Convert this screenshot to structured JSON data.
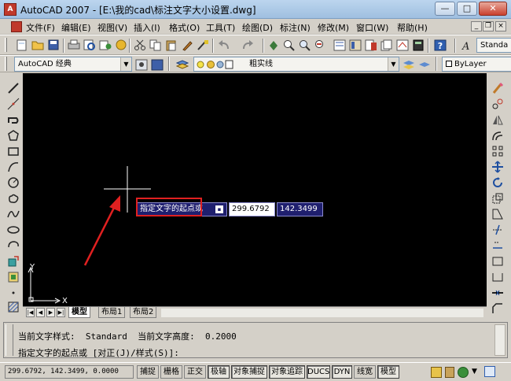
{
  "window": {
    "title": "AutoCAD 2007 - [E:\\我的cad\\标注文字大小设置.dwg]",
    "min_label": "—",
    "max_label": "□",
    "close_label": "✕"
  },
  "menu": {
    "items": [
      "文件(F)",
      "编辑(E)",
      "视图(V)",
      "插入(I)",
      "格式(O)",
      "工具(T)",
      "绘图(D)",
      "标注(N)",
      "修改(M)",
      "窗口(W)",
      "帮助(H)"
    ],
    "mdi_min": "_",
    "mdi_restore": "❐",
    "mdi_close": "×"
  },
  "toolbar": {
    "text_style_combo": "Standa",
    "workspace_combo": "AutoCAD 经典",
    "layer_combo": "粗实线",
    "color_combo": "ByLayer"
  },
  "canvas": {
    "prompt_label": "指定文字的起点或",
    "x_value": "299.6792",
    "y_value": "142.3499",
    "ucs_y": "Y",
    "ucs_x": "X"
  },
  "tabs": {
    "items": [
      "模型",
      "布局1",
      "布局2"
    ],
    "active": "模型"
  },
  "command": {
    "line1": "当前文字样式:  Standard  当前文字高度:  0.2000",
    "line2": "指定文字的起点或 [对正(J)/样式(S)]:"
  },
  "status": {
    "coords": "299.6792, 142.3499, 0.0000",
    "buttons": [
      "捕捉",
      "栅格",
      "正交",
      "极轴",
      "对象捕捉",
      "对象追踪",
      "DUCS",
      "DYN",
      "线宽",
      "模型"
    ]
  },
  "colors": {
    "canvas_bg": "#000000",
    "dyn_prompt_bg": "#1f1f6e",
    "dyn_input_bg": "#ffffff",
    "highlight_red": "#e02020",
    "arrow_red": "#e02020"
  }
}
